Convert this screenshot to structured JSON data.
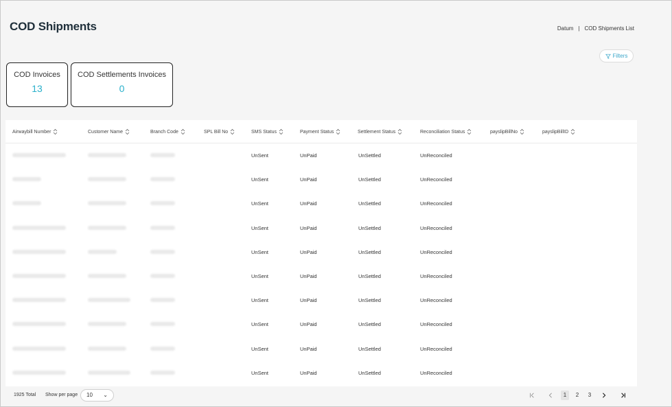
{
  "header": {
    "title": "COD Shipments",
    "breadcrumb": [
      "Datum",
      "COD Shipments List"
    ],
    "breadcrumb_sep": "|",
    "filters_label": "Filters"
  },
  "cards": [
    {
      "label": "COD Invoices",
      "value": "13"
    },
    {
      "label": "COD Settlements Invoices",
      "value": "0"
    }
  ],
  "table": {
    "columns": [
      "Airwaybill Number",
      "Customer Name",
      "Branch Code",
      "SPL Bill No",
      "SMS Status",
      "Payment Status",
      "Settlement Status",
      "Reconciliation Status",
      "payslipBillNo",
      "payslipBillID"
    ],
    "rows": [
      {
        "sms": "UnSent",
        "payment": "UnPaid",
        "settlement": "UnSettled",
        "reconciliation": "UnReconciled"
      },
      {
        "sms": "UnSent",
        "payment": "UnPaid",
        "settlement": "UnSettled",
        "reconciliation": "UnReconciled"
      },
      {
        "sms": "UnSent",
        "payment": "UnPaid",
        "settlement": "UnSettled",
        "reconciliation": "UnReconciled"
      },
      {
        "sms": "UnSent",
        "payment": "UnPaid",
        "settlement": "UnSettled",
        "reconciliation": "UnReconciled"
      },
      {
        "sms": "UnSent",
        "payment": "UnPaid",
        "settlement": "UnSettled",
        "reconciliation": "UnReconciled"
      },
      {
        "sms": "UnSent",
        "payment": "UnPaid",
        "settlement": "UnSettled",
        "reconciliation": "UnReconciled"
      },
      {
        "sms": "UnSent",
        "payment": "UnPaid",
        "settlement": "UnSettled",
        "reconciliation": "UnReconciled"
      },
      {
        "sms": "UnSent",
        "payment": "UnPaid",
        "settlement": "UnSettled",
        "reconciliation": "UnReconciled"
      },
      {
        "sms": "UnSent",
        "payment": "UnPaid",
        "settlement": "UnSettled",
        "reconciliation": "UnReconciled"
      },
      {
        "sms": "UnSent",
        "payment": "UnPaid",
        "settlement": "UnSettled",
        "reconciliation": "UnReconciled"
      }
    ]
  },
  "footer": {
    "total": "1925 Total",
    "show_per_page_label": "Show per page",
    "per_page_value": "10",
    "pages": [
      "1",
      "2",
      "3"
    ],
    "active_page": "1"
  },
  "icons": {
    "sort": "sort-updown-icon",
    "filter": "filter-icon",
    "first": "first-page-icon",
    "prev": "prev-page-icon",
    "next": "next-page-icon",
    "last": "last-page-icon"
  },
  "colors": {
    "accent": "#2ab0cb",
    "title": "#1f2f3a"
  }
}
